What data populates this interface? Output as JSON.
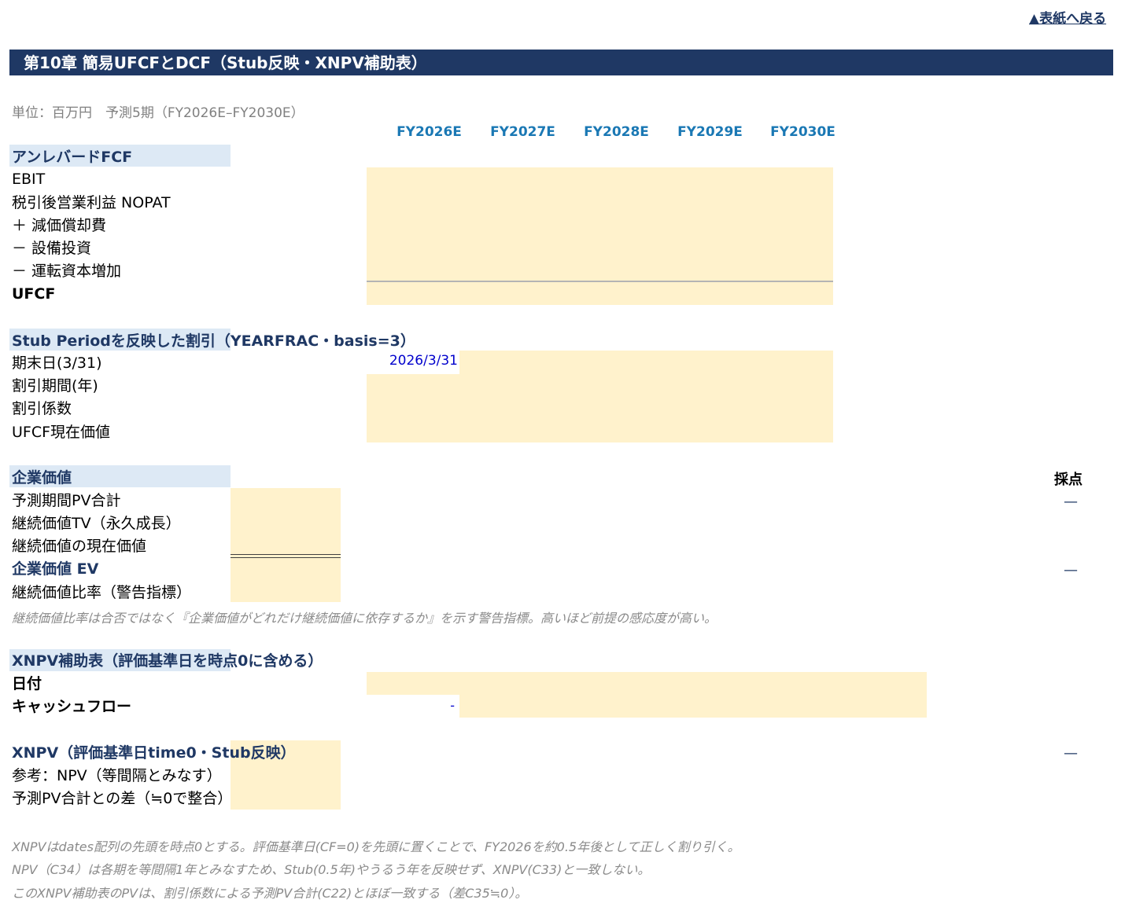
{
  "nav": {
    "back_link": "▲表紙へ戻る"
  },
  "chapter": {
    "title": "第10章 簡易UFCFとDCF（Stub反映・XNPV補助表）"
  },
  "unit_note": "単位：百万円　予測5期（FY2026E–FY2030E）",
  "columns": [
    "FY2026E",
    "FY2027E",
    "FY2028E",
    "FY2029E",
    "FY2030E"
  ],
  "ufcf_section": {
    "title": "アンレバードFCF",
    "rows": [
      "EBIT",
      "税引後営業利益 NOPAT",
      "＋ 減価償却費",
      "－ 設備投資",
      "－ 運転資本増加"
    ],
    "total": "UFCF"
  },
  "stub_section": {
    "title": "Stub Periodを反映した割引（YEARFRAC・basis=3）",
    "rows": [
      "期末日(3/31)",
      "割引期間(年)",
      "割引係数",
      "UFCF現在価値"
    ],
    "first_date": "2026/3/31"
  },
  "ev_section": {
    "title": "企業価値",
    "score_header": "採点",
    "rows": [
      "予測期間PV合計",
      "継続価値TV（永久成長）",
      "継続価値の現在価値"
    ],
    "ev_label": "企業価値 EV",
    "ratio_label": "継続価値比率（警告指標）",
    "note": "継続価値比率は合否ではなく『企業価値がどれだけ継続価値に依存するか』を示す警告指標。高いほど前提の感応度が高い。",
    "score_marks": [
      "—",
      "—"
    ]
  },
  "xnpv_table": {
    "title": "XNPV補助表（評価基準日を時点0に含める）",
    "date_label": "日付",
    "cf_label": "キャッシュフロー",
    "cf_first": "-"
  },
  "xnpv_result": {
    "title": "XNPV（評価基準日time0・Stub反映）",
    "npv_label": "参考：NPV（等間隔とみなす）",
    "diff_label": "予測PV合計との差（≒0で整合）",
    "score_mark": "—"
  },
  "notes": [
    "XNPVはdates配列の先頭を時点0とする。評価基準日(CF=0)を先頭に置くことで、FY2026を約0.5年後として正しく割り引く。",
    "NPV（C34）は各期を等間隔1年とみなすため、Stub(0.5年)やうるう年を反映せず、XNPV(C33)と一致しない。",
    "このXNPV補助表のPVは、割引係数による予測PV合計(C22)とほぼ一致する（差C35≒0）。"
  ],
  "colors": {
    "header_bg": "#1f3864",
    "section_bg": "#dde9f5",
    "input_bg": "#fff2cc",
    "column_header": "#1a78b4",
    "link": "#1f3864"
  }
}
